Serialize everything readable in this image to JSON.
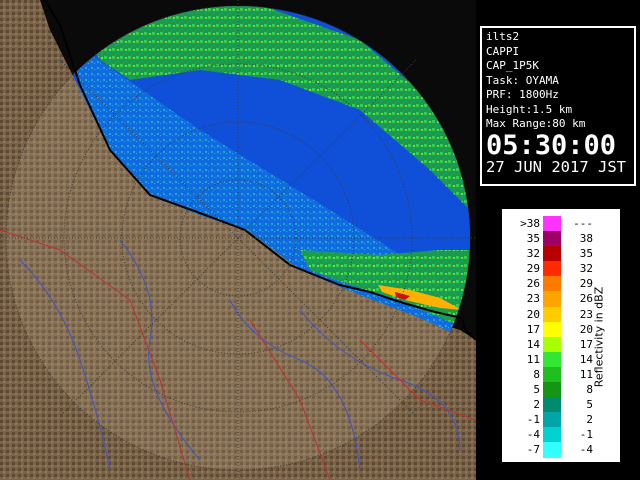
{
  "info": {
    "lines": [
      "ilts2",
      "CAPPI",
      "CAP_1P5K",
      "Task: OYAMA",
      "PRF: 1800Hz",
      "Height:1.5 km",
      "Max Range:80 km"
    ],
    "time": "05:30:00",
    "date": "27 JUN 2017 JST"
  },
  "legend": {
    "unit_label": "Reflectivity in dBZ",
    "rows": [
      {
        "left": ">38",
        "right": "---",
        "color": "#ff33ff"
      },
      {
        "left": "35",
        "right": "38",
        "color": "#9e0066"
      },
      {
        "left": "32",
        "right": "35",
        "color": "#b80000"
      },
      {
        "left": "29",
        "right": "32",
        "color": "#ff2a00"
      },
      {
        "left": "26",
        "right": "29",
        "color": "#ff7a00"
      },
      {
        "left": "23",
        "right": "26",
        "color": "#ffa300"
      },
      {
        "left": "20",
        "right": "23",
        "color": "#ffcc00"
      },
      {
        "left": "17",
        "right": "20",
        "color": "#ffff00"
      },
      {
        "left": "14",
        "right": "17",
        "color": "#a8ff00"
      },
      {
        "left": "11",
        "right": "14",
        "color": "#33e633"
      },
      {
        "left": "8",
        "right": "11",
        "color": "#1fbf1f"
      },
      {
        "left": "5",
        "right": "8",
        "color": "#149614"
      },
      {
        "left": "2",
        "right": "5",
        "color": "#008a6e"
      },
      {
        "left": "-1",
        "right": "2",
        "color": "#00a6a6"
      },
      {
        "left": "-4",
        "right": "-1",
        "color": "#00d2d2"
      },
      {
        "left": "-7",
        "right": "-4",
        "color": "#33ffff"
      }
    ]
  },
  "colors": {
    "sea": "#1050d8",
    "land": "#7a6448",
    "range_ring": "#3a3a3a",
    "coast": "#000000"
  }
}
